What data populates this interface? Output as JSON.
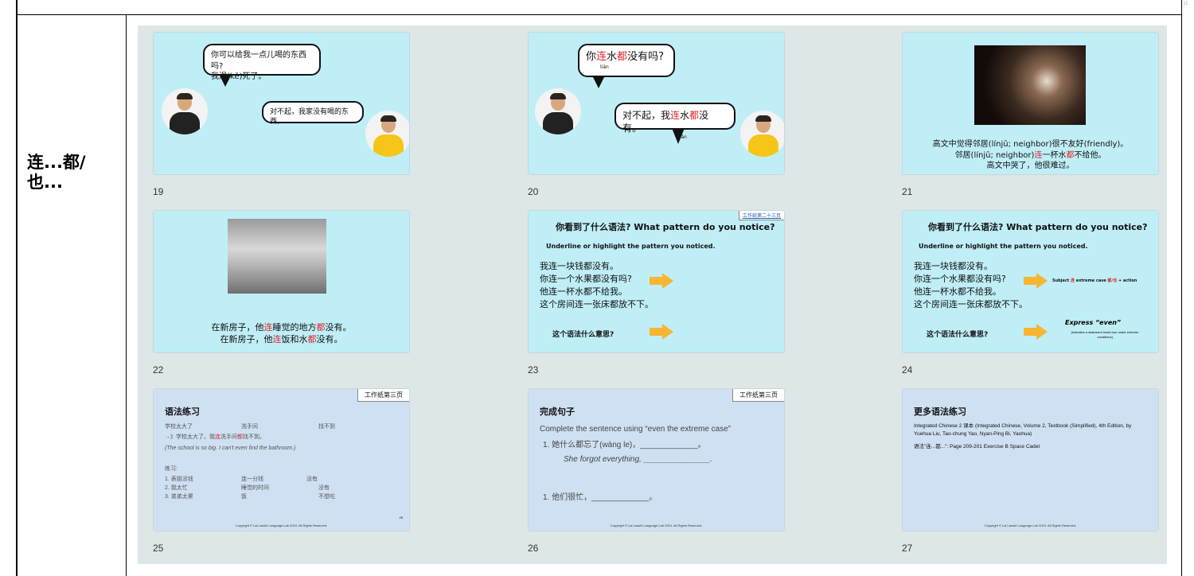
{
  "row_label": [
    "连...都/",
    "也..."
  ],
  "slides": {
    "s19": {
      "num": "19",
      "bubble1": [
        "你可以给我一点儿喝的东西吗?",
        "我渴(kě)死了。"
      ],
      "bubble2": "对不起，我家没有喝的东西。"
    },
    "s20": {
      "num": "20",
      "bubble1_pre": "你",
      "bubble1_lian": "连",
      "bubble1_mid": "水",
      "bubble1_dou": "都",
      "bubble1_post": "没有吗?",
      "pinyin1": "lián",
      "bubble2_pre": "对不起，我",
      "bubble2_lian": "连",
      "bubble2_mid": "水",
      "bubble2_dou": "都",
      "bubble2_post": "没有。",
      "pinyin2": "lián"
    },
    "s21": {
      "num": "21",
      "line1": "高文中觉得邻居(línjū; neighbor)很不友好(friendly)。",
      "line2_pre": "邻居(línjū; neighbor)",
      "line2_lian": "连",
      "line2_mid": "一杯水",
      "line2_dou": "都",
      "line2_post": "不给他。",
      "line3": "高文中哭了，他很难过。"
    },
    "s22": {
      "num": "22",
      "line1_pre": "在新房子，他",
      "line1_lian": "连",
      "line1_mid": "睡觉的地方",
      "line1_dou": "都",
      "line1_post": "没有。",
      "line2_pre": "在新房子，他",
      "line2_lian": "连",
      "line2_mid": "饭和水",
      "line2_dou": "都",
      "line2_post": "没有。"
    },
    "s23": {
      "num": "23",
      "tag": "工作纸第二十三页",
      "title": "你看到了什么语法? What pattern do you notice?",
      "sub": "Underline or highlight the pattern you noticed.",
      "lines": [
        "我连一块钱都没有。",
        "你连一个水果都没有吗?",
        "他连一杯水都不给我。",
        "这个房间连一张床都放不下。"
      ],
      "question": "这个语法什么意思?"
    },
    "s24": {
      "num": "24",
      "title": "你看到了什么语法? What pattern do you notice?",
      "sub": "Underline or highlight the pattern you noticed.",
      "lines": [
        "我连一块钱都没有。",
        "你连一个水果都没有吗?",
        "他连一杯水都不给我。",
        "这个房间连一张床都放不下。"
      ],
      "question": "这个语法什么意思?",
      "pattern_pre": "Subject ",
      "pattern_lian": "连",
      "pattern_mid": " extreme case ",
      "pattern_dou": "都/也",
      "pattern_post": " + action",
      "express": "Express “even”",
      "note": "[Indicates a statement holds true under extreme conditions]"
    },
    "s25": {
      "num": "25",
      "tag": "工作纸第三页",
      "title": "语法练习",
      "words": [
        "学校太大了",
        "洗手间",
        "找不到"
      ],
      "example_pre": "→》学校太大了。我",
      "example_lian": "连",
      "example_mid": "洗手间",
      "example_dou": "都",
      "example_post": "找不到。",
      "translation": "(The school is so big. I can't even find the bathroom.)",
      "practice": "练习:",
      "rows": [
        [
          "1. 表姐没钱",
          "连一分钱",
          "没有"
        ],
        [
          "2. 我太忙",
          "睡觉的时间",
          "没有"
        ],
        [
          "3. 弟弟太累",
          "饭",
          "不想吃"
        ]
      ],
      "copyright": "Copyright © Lai Laoshi Language Lab 2024. All Rights Reserved.",
      "page": "25"
    },
    "s26": {
      "num": "26",
      "tag": "工作纸第三页",
      "title": "完成句子",
      "instruction": "Complete the sentence using “even the extreme case”",
      "q1": "1. 她什么都忘了(wàng le)，_____________。",
      "q1_en": "She forgot everything, _______________.",
      "q2": "1. 他们很忙，_____________。",
      "copyright": "Copyright © Lai Laoshi Language Lab 2024. All Rights Reserved."
    },
    "s27": {
      "num": "27",
      "title": "更多语法练习",
      "ref": "Integrated Chinese 2 课本 (Integrated Chinese, Volume 2, Textbook (Simplified), 4th Edition, by Yuehua Liu, Tao-chung Yao, Nyan-Ping Bi, Yaohua)",
      "exercise": "语法\"连...都...\": Page 209-201 Exercise B Space Cadet",
      "copyright": "Copyright © Lai Laoshi Language Lab 2024. All Rights Reserved."
    }
  }
}
